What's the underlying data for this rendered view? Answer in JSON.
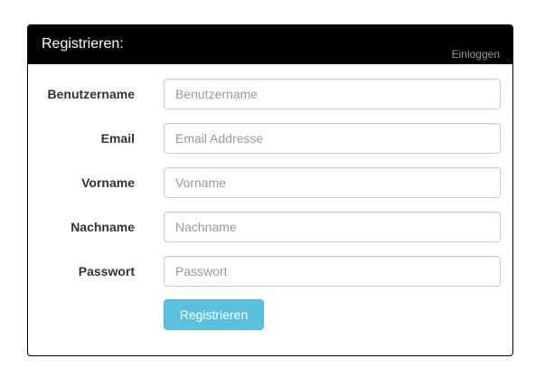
{
  "header": {
    "title": "Registrieren:",
    "login_link": "Einloggen"
  },
  "form": {
    "username": {
      "label": "Benutzername",
      "placeholder": "Benutzername",
      "value": ""
    },
    "email": {
      "label": "Email",
      "placeholder": "Email Addresse",
      "value": ""
    },
    "firstname": {
      "label": "Vorname",
      "placeholder": "Vorname",
      "value": ""
    },
    "lastname": {
      "label": "Nachname",
      "placeholder": "Nachname",
      "value": ""
    },
    "password": {
      "label": "Passwort",
      "placeholder": "Passwort",
      "value": ""
    },
    "submit_label": "Registrieren"
  },
  "colors": {
    "header_bg": "#000000",
    "button_bg": "#5bc0de",
    "link": "#999999"
  }
}
